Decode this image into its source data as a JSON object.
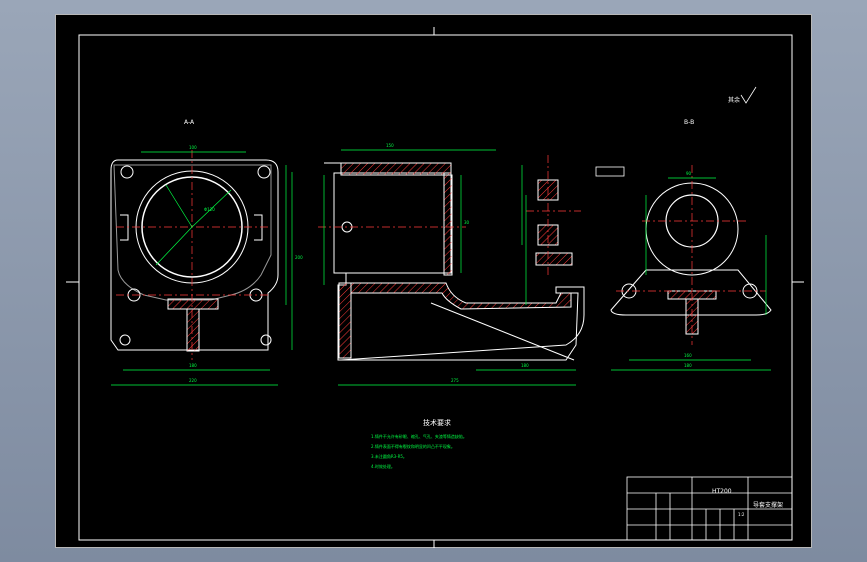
{
  "views": {
    "left_label": "A-A",
    "right_label": "B-B",
    "roughness_note": "其余"
  },
  "dimensions": {
    "left_top_width": "100",
    "left_bottom_width": "180",
    "left_overall_width": "220",
    "left_height": "200",
    "left_inner_dia": "Φ120",
    "middle_top": "150",
    "middle_bottom": "275",
    "middle_length": "180",
    "middle_height": "30",
    "right_top": "90",
    "right_mid": "160",
    "right_bottom": "180"
  },
  "tech_requirements": {
    "title": "技术要求",
    "lines": [
      "1.铸件不允许有砂眼、缩孔、气孔、夹渣等铸造缺陷。",
      "2.铸件表面不得有裂纹和明显的凹凸不平现象。",
      "3.未注圆角R3-R5。",
      "4.时效处理。"
    ]
  },
  "title_block": {
    "material": "HT200",
    "part_name": "导套支撑架",
    "scale": "1:2"
  },
  "colors": {
    "background": "#000000",
    "outline": "#ffffff",
    "dimension": "#00ff44",
    "hatch": "#ff3b3b",
    "centerline": "#ff3b3b",
    "text": "#e8e8e8"
  }
}
